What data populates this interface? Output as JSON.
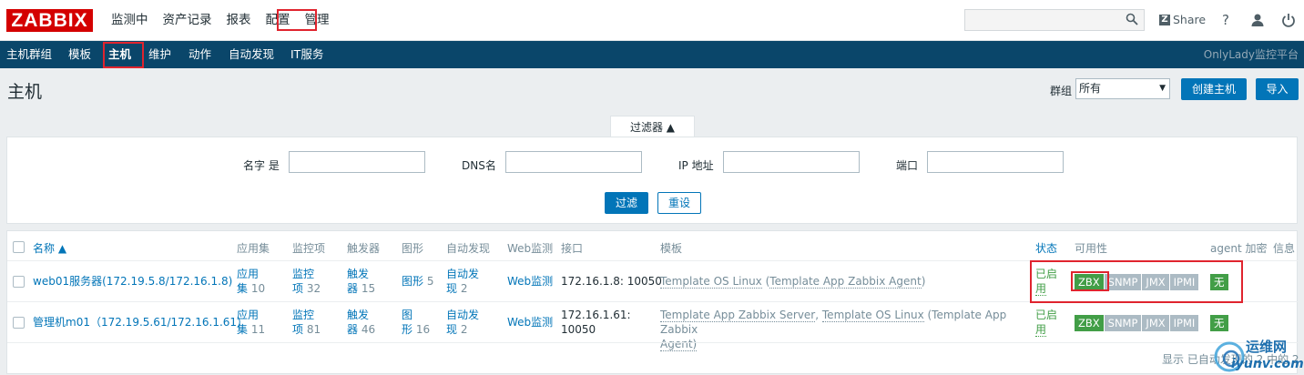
{
  "header": {
    "logo": "ZABBIX",
    "nav": [
      "监测中",
      "资产记录",
      "报表",
      "配置",
      "管理"
    ],
    "share": "Share",
    "help": "?"
  },
  "subnav": {
    "items": [
      "主机群组",
      "模板",
      "主机",
      "维护",
      "动作",
      "自动发现",
      "IT服务"
    ],
    "right": "OnlyLady监控平台"
  },
  "page": {
    "title": "主机",
    "group_label": "群组",
    "group_value": "所有",
    "create_button": "创建主机",
    "import_button": "导入"
  },
  "filter": {
    "tab": "过滤器 ▲",
    "name_label": "名字 是",
    "dns_label": "DNS名",
    "ip_label": "IP 地址",
    "port_label": "端口",
    "apply": "过滤",
    "reset": "重设"
  },
  "table": {
    "headers": {
      "name": "名称 ▲",
      "apps": "应用集",
      "items": "监控项",
      "triggers": "触发器",
      "graphs": "图形",
      "discovery": "自动发现",
      "web": "Web监测",
      "iface": "接口",
      "templates": "模板",
      "status": "状态",
      "avail": "可用性",
      "enc": "agent 加密",
      "info": "信息"
    },
    "rows": [
      {
        "name": "web01服务器(172.19.5.8/172.16.1.8)",
        "apps_a": "应用",
        "apps_b": "集",
        "apps_n": "10",
        "items_a": "监控",
        "items_b": "项",
        "items_n": "32",
        "trig_a": "触发",
        "trig_b": "器",
        "trig_n": "15",
        "graphs_a": "图形",
        "graphs_n": "5",
        "graphs_b": "",
        "disc_a": "自动发",
        "disc_b": "现",
        "disc_n": "2",
        "web": "Web监测",
        "iface_a": "172.16.1.8: 10050",
        "iface_b": "",
        "tpl1": "Template OS Linux",
        "tpl_open": " (",
        "tpl2": "Template App Zabbix Agent",
        "tpl_close": ")",
        "tpl3": "",
        "status_a": "已启",
        "status_b": "用",
        "avail": [
          "ZBX",
          "SNMP",
          "JMX",
          "IPMI"
        ],
        "enc": "无"
      },
      {
        "name": "管理机m01（172.19.5.61/172.16.1.61）",
        "apps_a": "应用",
        "apps_b": "集",
        "apps_n": "11",
        "items_a": "监控",
        "items_b": "项",
        "items_n": "81",
        "trig_a": "触发",
        "trig_b": "器",
        "trig_n": "46",
        "graphs_a": "图",
        "graphs_b": "形",
        "graphs_n": "16",
        "disc_a": "自动发",
        "disc_b": "现",
        "disc_n": "2",
        "web": "Web监测",
        "iface_a": "172.16.1.61:",
        "iface_b": "10050",
        "tpl1": "Template App Zabbix Server",
        "tpl_open": ", ",
        "tpl2": "Template OS Linux",
        "tpl_close": " (Template App Zabbix",
        "tpl3": "Agent)",
        "status_a": "已启",
        "status_b": "用",
        "avail": [
          "ZBX",
          "SNMP",
          "JMX",
          "IPMI"
        ],
        "enc": "无"
      }
    ]
  },
  "footer": {
    "text": "显示 已自动发现的 2 中的 2"
  },
  "watermark": {
    "text1": "运维网",
    "text2": "iyunv.com"
  }
}
